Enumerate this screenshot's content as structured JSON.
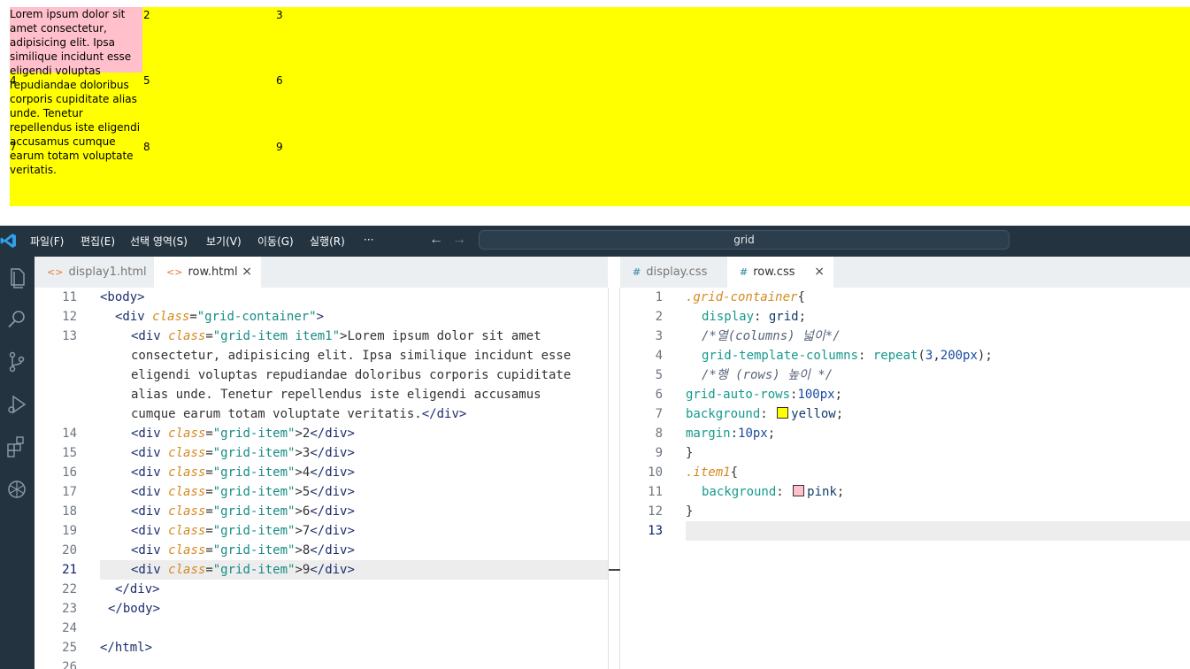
{
  "preview": {
    "item1_text": "Lorem ipsum dolor sit amet consectetur, adipisicing elit. Ipsa similique incidunt esse eligendi voluptas repudiandae doloribus corporis cupiditate alias unde. Tenetur repellendus iste eligendi accusamus cumque earum totam voluptate veritatis.",
    "items": [
      "2",
      "3",
      "4",
      "5",
      "6",
      "7",
      "8",
      "9"
    ],
    "colors": {
      "container": "#ffff00",
      "item1": "#ffc0cb"
    }
  },
  "titlebar": {
    "menu": [
      "파일(F)",
      "편집(E)",
      "선택 영역(S)",
      "보기(V)",
      "이동(G)",
      "실행(R)",
      "···"
    ],
    "search": "grid",
    "back_icon": "arrow-left-icon",
    "forward_icon": "arrow-right-icon"
  },
  "left_tabs": [
    {
      "label": "display1.html",
      "active": false
    },
    {
      "label": "row.html",
      "active": true,
      "close": "×"
    }
  ],
  "right_tabs": [
    {
      "label": "display.css",
      "active": false,
      "icon": "#"
    },
    {
      "label": "row.css",
      "active": true,
      "icon": "#",
      "close": "×"
    }
  ],
  "html_editor": {
    "line_numbers": [
      "11",
      "12",
      "13",
      "14",
      "15",
      "16",
      "17",
      "18",
      "19",
      "20",
      "21",
      "22",
      "23",
      "24",
      "25",
      "26"
    ],
    "current_line": "21",
    "lines": {
      "l11": "<body>",
      "l12_pre": "  <div ",
      "l12_attr": "class",
      "l12_str": "\"grid-container\"",
      "l13_attr": "class",
      "l13_str": "\"grid-item item1\"",
      "l13_text_1": ">Lorem ipsum dolor sit amet",
      "l13_text_2": "consectetur, adipisicing elit. Ipsa similique incidunt esse",
      "l13_text_3": "eligendi voluptas repudiandae doloribus corporis cupiditate",
      "l13_text_4": "alias unde. Tenetur repellendus iste eligendi accusamus",
      "l13_text_5": "cumque earum totam voluptate veritatis.",
      "grid_item_str": "\"grid-item\"",
      "items": [
        "2",
        "3",
        "4",
        "5",
        "6",
        "7",
        "8",
        "9"
      ],
      "close_div": "</div>",
      "close_body": "</body>",
      "close_html": "</html>"
    }
  },
  "css_editor": {
    "line_numbers": [
      "1",
      "2",
      "3",
      "4",
      "5",
      "6",
      "7",
      "8",
      "9",
      "10",
      "11",
      "12",
      "13"
    ],
    "current_line": "13",
    "sel1": ".grid-container",
    "prop_display": "display",
    "val_grid": "grid",
    "comment_cols": "/*열(columns) 넓이*/",
    "prop_gtc": "grid-template-columns",
    "func_repeat": "repeat",
    "repeat_args_a": "3",
    "repeat_args_b": "200px",
    "comment_rows": "/*행 (rows) 높이 */",
    "prop_gar": "grid-auto-rows",
    "val_100px": "100px",
    "prop_bg": "background",
    "val_yellow": "yellow",
    "prop_margin": "margin",
    "val_10px": "10px",
    "sel2": ".item1",
    "val_pink": "pink",
    "swatch_yellow": "#ffff00",
    "swatch_pink": "#ffc0cb"
  }
}
